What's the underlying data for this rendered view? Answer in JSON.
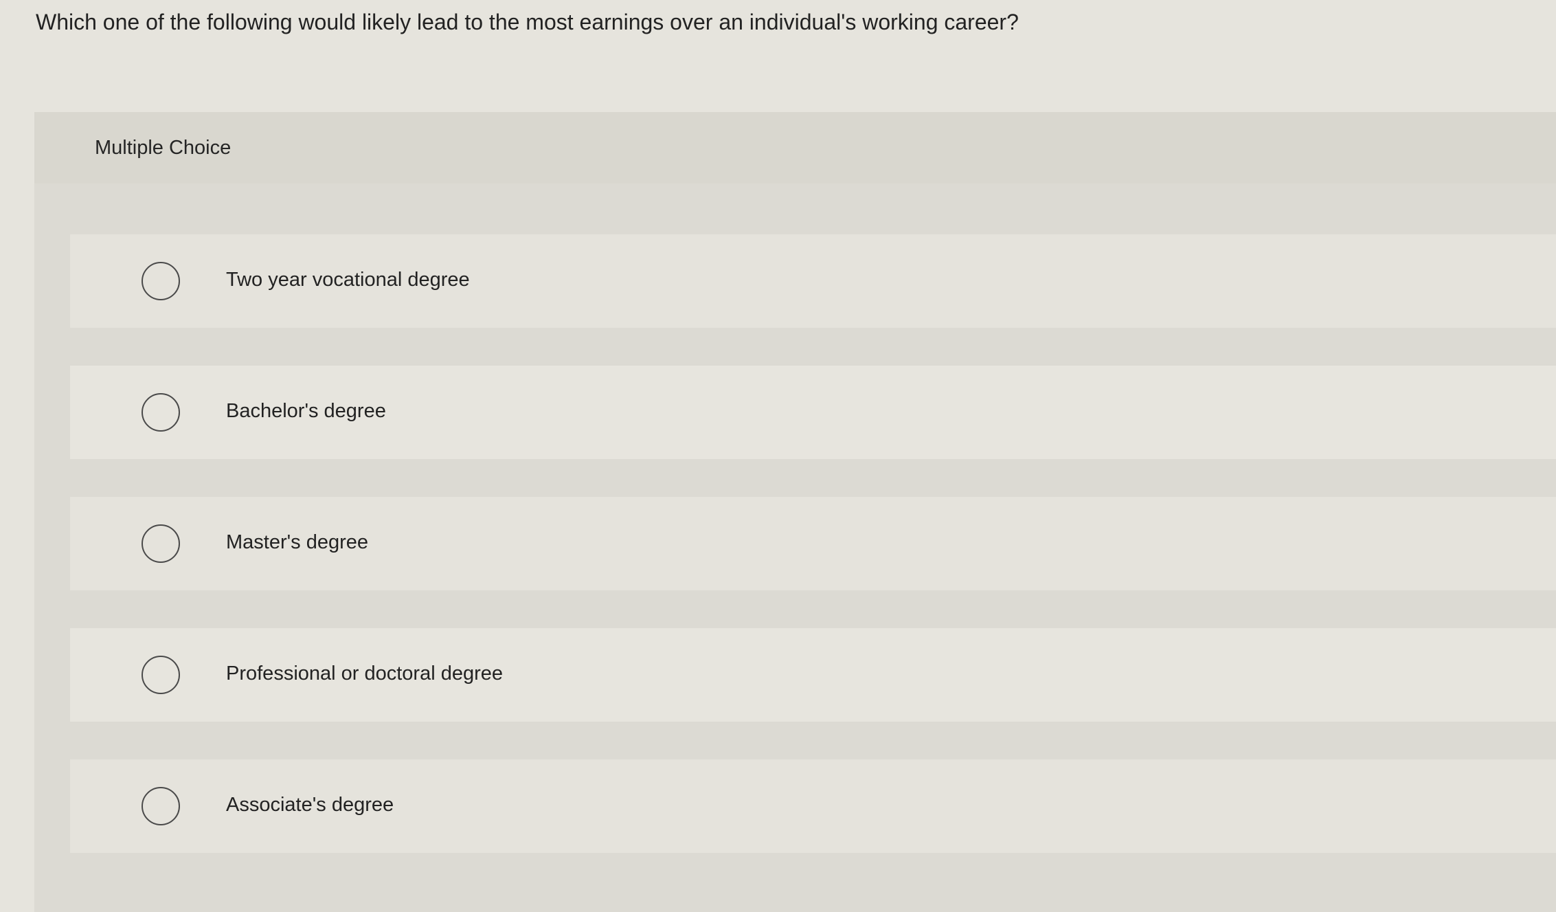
{
  "question": "Which one of the following would likely lead to the most earnings over an individual's working career?",
  "card": {
    "header_label": "Multiple Choice"
  },
  "options": [
    {
      "label": "Two year vocational degree"
    },
    {
      "label": "Bachelor's degree"
    },
    {
      "label": "Master's degree"
    },
    {
      "label": "Professional or doctoral degree"
    },
    {
      "label": "Associate's degree"
    }
  ]
}
